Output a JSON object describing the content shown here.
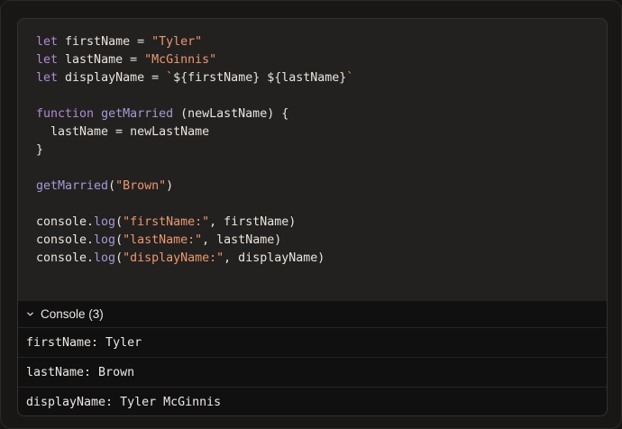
{
  "editor": {
    "lines": [
      [
        {
          "t": "kw",
          "v": "let"
        },
        {
          "t": "plain",
          "v": " firstName = "
        },
        {
          "t": "str",
          "v": "\"Tyler\""
        }
      ],
      [
        {
          "t": "kw",
          "v": "let"
        },
        {
          "t": "plain",
          "v": " lastName = "
        },
        {
          "t": "str",
          "v": "\"McGinnis\""
        }
      ],
      [
        {
          "t": "kw",
          "v": "let"
        },
        {
          "t": "plain",
          "v": " displayName = "
        },
        {
          "t": "str",
          "v": "`"
        },
        {
          "t": "plain",
          "v": "${firstName} ${lastName}"
        },
        {
          "t": "str",
          "v": "`"
        }
      ],
      [],
      [
        {
          "t": "kw",
          "v": "function"
        },
        {
          "t": "plain",
          "v": " "
        },
        {
          "t": "fn",
          "v": "getMarried"
        },
        {
          "t": "plain",
          "v": " (newLastName) {"
        }
      ],
      [
        {
          "t": "plain",
          "v": "  lastName = newLastName"
        }
      ],
      [
        {
          "t": "plain",
          "v": "}"
        }
      ],
      [],
      [
        {
          "t": "fn",
          "v": "getMarried"
        },
        {
          "t": "plain",
          "v": "("
        },
        {
          "t": "str",
          "v": "\"Brown\""
        },
        {
          "t": "plain",
          "v": ")"
        }
      ],
      [],
      [
        {
          "t": "plain",
          "v": "console."
        },
        {
          "t": "fn",
          "v": "log"
        },
        {
          "t": "plain",
          "v": "("
        },
        {
          "t": "str",
          "v": "\"firstName:\""
        },
        {
          "t": "plain",
          "v": ", firstName)"
        }
      ],
      [
        {
          "t": "plain",
          "v": "console."
        },
        {
          "t": "fn",
          "v": "log"
        },
        {
          "t": "plain",
          "v": "("
        },
        {
          "t": "str",
          "v": "\"lastName:\""
        },
        {
          "t": "plain",
          "v": ", lastName)"
        }
      ],
      [
        {
          "t": "plain",
          "v": "console."
        },
        {
          "t": "fn",
          "v": "log"
        },
        {
          "t": "plain",
          "v": "("
        },
        {
          "t": "str",
          "v": "\"displayName:\""
        },
        {
          "t": "plain",
          "v": ", displayName)"
        }
      ]
    ]
  },
  "console": {
    "title": "Console (3)",
    "toggle_icon": "chevron-down-icon",
    "rows": [
      "firstName: Tyler",
      "lastName: Brown",
      "displayName: Tyler McGinnis"
    ]
  },
  "colors": {
    "keyword": "#b189d6",
    "function": "#a59ad6",
    "string": "#ea9870",
    "text": "#e9e4df",
    "editor_bg": "#232120",
    "console_bg": "#111010"
  }
}
